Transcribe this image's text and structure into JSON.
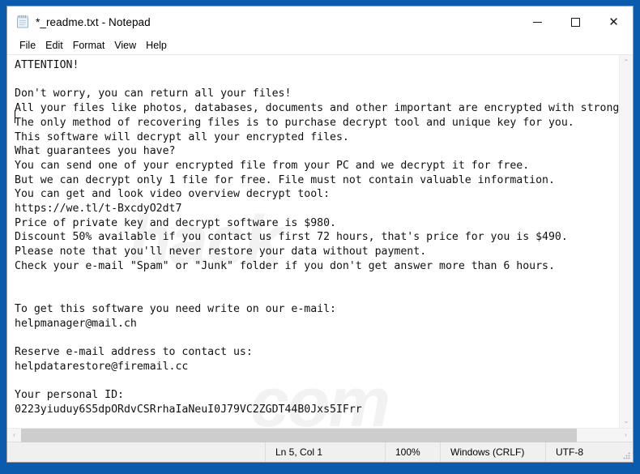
{
  "window": {
    "title": "*_readme.txt - Notepad",
    "icon": "notepad-icon",
    "controls": {
      "minimize": "—",
      "maximize": "□",
      "close": "✕"
    }
  },
  "menu": {
    "items": [
      {
        "label": "File"
      },
      {
        "label": "Edit"
      },
      {
        "label": "Format"
      },
      {
        "label": "View"
      },
      {
        "label": "Help"
      }
    ]
  },
  "document": {
    "text": "ATTENTION!\n\nDon't worry, you can return all your files!\nAll your files like photos, databases, documents and other important are encrypted with strongest encryption and unique key.\nThe only method of recovering files is to purchase decrypt tool and unique key for you.\nThis software will decrypt all your encrypted files.\nWhat guarantees you have?\nYou can send one of your encrypted file from your PC and we decrypt it for free.\nBut we can decrypt only 1 file for free. File must not contain valuable information.\nYou can get and look video overview decrypt tool:\nhttps://we.tl/t-BxcdyO2dt7\nPrice of private key and decrypt software is $980.\nDiscount 50% available if you contact us first 72 hours, that's price for you is $490.\nPlease note that you'll never restore your data without payment.\nCheck your e-mail \"Spam\" or \"Junk\" folder if you don't get answer more than 6 hours.\n\n\nTo get this software you need write on our e-mail:\nhelpmanager@mail.ch\n\nReserve e-mail address to contact us:\nhelpdatarestore@firemail.cc\n\nYour personal ID:\n0223yiuduy6S5dpORdvCSRrhaIaNeuI0J79VC2ZGDT44B0Jxs5IFrr",
    "url": "https://we.tl/t-BxcdyO2dt7",
    "price_full": "$980",
    "price_discounted": "$490",
    "discount_percent": "50%",
    "discount_window_hours": "72",
    "response_time_hours": "6",
    "email_primary": "helpmanager@mail.ch",
    "email_reserve": "helpdatarestore@firemail.cc",
    "personal_id": "0223yiuduy6S5dpORdvCSRrhaIaNeuI0J79VC2ZGDT44B0Jxs5IFrr"
  },
  "watermark": {
    "line1": "hack",
    "line2": "com"
  },
  "scrollbars": {
    "vertical": {
      "up_arrow": "⌃",
      "down_arrow": "⌄"
    },
    "horizontal": {
      "left_arrow": "‹",
      "right_arrow": "›"
    }
  },
  "statusbar": {
    "position": "Ln 5, Col 1",
    "zoom": "100%",
    "line_ending": "Windows (CRLF)",
    "encoding": "UTF-8"
  },
  "colors": {
    "desktop": "#0a5bad",
    "window_bg": "#ffffff",
    "statusbar_bg": "#f0f0f0",
    "scrollbar_thumb": "#cdcdcd"
  }
}
